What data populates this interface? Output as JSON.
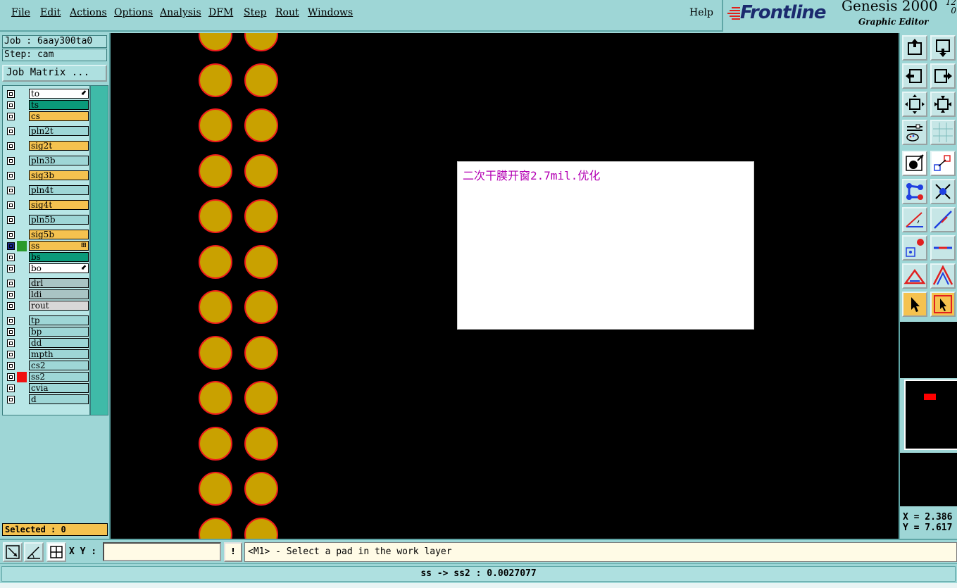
{
  "menubar": {
    "items": [
      {
        "label": "File"
      },
      {
        "label": "Edit"
      },
      {
        "label": "Actions"
      },
      {
        "label": "Options"
      },
      {
        "label": "Analysis"
      },
      {
        "label": "DFM"
      },
      {
        "label": "Step"
      },
      {
        "label": "Rout"
      },
      {
        "label": "Windows"
      }
    ],
    "help": "Help"
  },
  "brand": {
    "logo": "Frontline",
    "product": "Genesis 2000",
    "subtitle": "Graphic Editor",
    "version_top": "12",
    "version_bottom": "0"
  },
  "job": {
    "job_line": "Job : 6aay300ta0",
    "step_line": "Step: cam",
    "matrix_button": "Job Matrix ..."
  },
  "layers": [
    {
      "name": "to",
      "color": "#ffffff",
      "mark": "⬋"
    },
    {
      "name": "ts",
      "color": "#0a9a7a"
    },
    {
      "name": "cs",
      "color": "#f5c24f"
    },
    {
      "name": "pln2t",
      "color": "#9ed6d6"
    },
    {
      "name": "sig2t",
      "color": "#f5c24f"
    },
    {
      "name": "pln3b",
      "color": "#9ed6d6"
    },
    {
      "name": "sig3b",
      "color": "#f5c24f"
    },
    {
      "name": "pln4t",
      "color": "#9ed6d6"
    },
    {
      "name": "sig4t",
      "color": "#f5c24f"
    },
    {
      "name": "pln5b",
      "color": "#9ed6d6"
    },
    {
      "name": "sig5b",
      "color": "#f5c24f"
    },
    {
      "name": "ss",
      "color": "#f5c24f",
      "swatch": "#2a9a2a",
      "work": true,
      "mark": "⊞"
    },
    {
      "name": "bs",
      "color": "#0a9a7a"
    },
    {
      "name": "bo",
      "color": "#ffffff",
      "mark": "⬋"
    },
    {
      "name": "drl",
      "color": "#a9c4c4"
    },
    {
      "name": "ldi",
      "color": "#a9c4c4"
    },
    {
      "name": "rout",
      "color": "#d8d8d8"
    },
    {
      "name": "tp",
      "color": "#9ed6d6"
    },
    {
      "name": "bp",
      "color": "#9ed6d6"
    },
    {
      "name": "dd",
      "color": "#9ed6d6"
    },
    {
      "name": "mpth",
      "color": "#9ed6d6"
    },
    {
      "name": "cs2",
      "color": "#9ed6d6"
    },
    {
      "name": "ss2",
      "color": "#9ed6d6",
      "swatch": "#f01010"
    },
    {
      "name": "cvia",
      "color": "#9ed6d6"
    },
    {
      "name": "d",
      "color": "#9ed6d6"
    }
  ],
  "selected": "Selected : 0",
  "canvas": {
    "note_text": "二次干膜开窗2.7mil.优化",
    "pad_color": "#c9a100",
    "pad_outline": "#f01c1c"
  },
  "coords": {
    "x": "X = 2.386",
    "y": "Y = 7.617"
  },
  "bottom": {
    "xy_label": "X Y :",
    "xy_value": "",
    "warn": "!",
    "prompt": "<M1> - Select a pad in the work layer",
    "status": "ss -> ss2 : 0.0027077"
  }
}
